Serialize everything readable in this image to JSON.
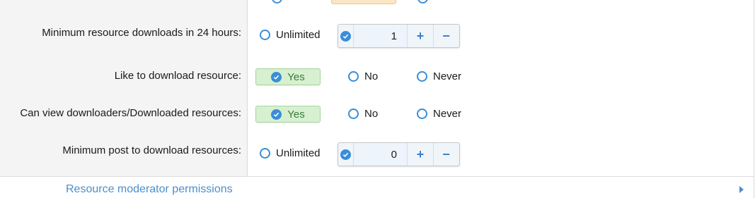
{
  "rows": [
    {
      "label": "Minimum resource downloads in 24 hours:",
      "unlimited_label": "Unlimited",
      "value": "1"
    },
    {
      "label": "Like to download resource:",
      "options": [
        "Yes",
        "No",
        "Never"
      ],
      "selected": "Yes"
    },
    {
      "label": "Can view downloaders/Downloaded resources:",
      "options": [
        "Yes",
        "No",
        "Never"
      ],
      "selected": "Yes"
    },
    {
      "label": "Minimum post to download resources:",
      "unlimited_label": "Unlimited",
      "value": "0"
    }
  ],
  "stepper": {
    "plus": "+",
    "minus": "−"
  },
  "section": {
    "title": "Resource moderator permissions"
  },
  "colors": {
    "accent": "#3a8dd8",
    "selected_bg": "#d6f0d0",
    "selected_text": "#3d7a3a",
    "link": "#4a8fcf",
    "label_column_bg": "#f4f4f4"
  },
  "icons": {
    "radio": "radio-circle-icon",
    "check": "check-circle-icon",
    "expand": "caret-right-icon"
  }
}
